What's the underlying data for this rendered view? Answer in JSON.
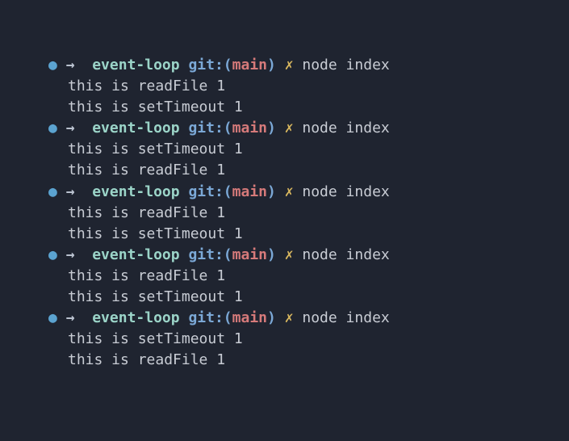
{
  "prompt": {
    "bullet": "●",
    "arrow": "→",
    "dir": "event-loop",
    "git_prefix": "git",
    "git_colon": ":",
    "git_open": "(",
    "git_branch": "main",
    "git_close": ")",
    "dirty": "✗"
  },
  "runs": [
    {
      "command": "node index",
      "output": [
        "this is readFile 1",
        "this is setTimeout 1"
      ]
    },
    {
      "command": "node index",
      "output": [
        "this is setTimeout 1",
        "this is readFile 1"
      ]
    },
    {
      "command": "node index",
      "output": [
        "this is readFile 1",
        "this is setTimeout 1"
      ]
    },
    {
      "command": "node index",
      "output": [
        "this is readFile 1",
        "this is setTimeout 1"
      ]
    },
    {
      "command": "node index",
      "output": [
        "this is setTimeout 1",
        "this is readFile 1"
      ]
    }
  ]
}
